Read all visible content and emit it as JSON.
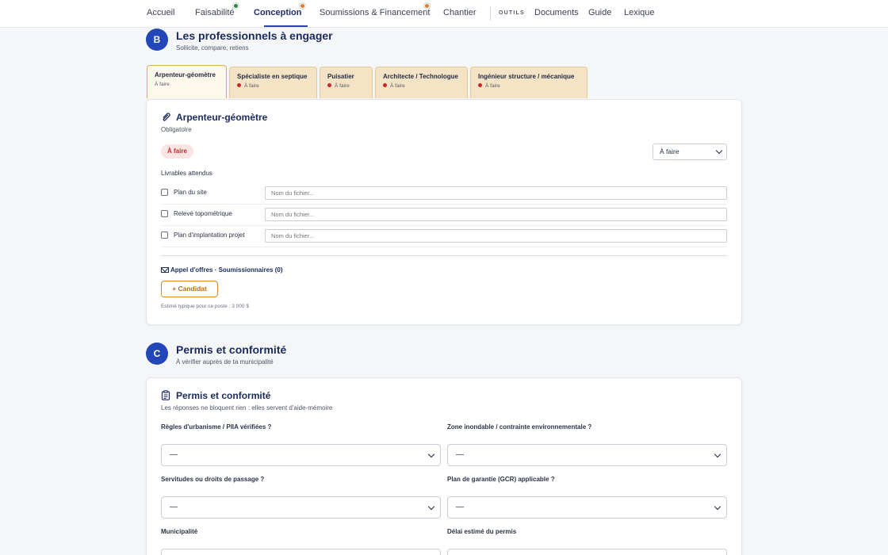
{
  "nav": {
    "items": [
      {
        "label": "Accueil"
      },
      {
        "label": "Faisabilité",
        "dot": "green"
      },
      {
        "label": "Conception",
        "dot": "orange",
        "active": true
      },
      {
        "label": "Soumissions & Financement",
        "dot": "orange"
      },
      {
        "label": "Chantier"
      }
    ],
    "tools_heading": "OUTILS",
    "tools": [
      {
        "label": "Documents"
      },
      {
        "label": "Guide"
      },
      {
        "label": "Lexique"
      }
    ]
  },
  "section_b": {
    "letter": "B",
    "title": "Les professionnels à engager",
    "subtitle": "Sollicite, compare, retiens",
    "tabs": [
      {
        "label": "Arpenteur-géomètre",
        "status": "À faire",
        "active": true
      },
      {
        "label": "Spécialiste en septique",
        "status": "À faire"
      },
      {
        "label": "Puisatier",
        "status": "À faire"
      },
      {
        "label": "Architecte / Technologue",
        "status": "À faire"
      },
      {
        "label": "Ingénieur structure / mécanique",
        "status": "À faire"
      }
    ],
    "card": {
      "icon": "paperclip-icon",
      "title": "Arpenteur-géomètre",
      "subtitle": "Obligatoire",
      "badge": "À faire",
      "status_select": "À faire",
      "deliverables_heading": "Livrables attendus",
      "deliverables": [
        {
          "label": "Plan du site",
          "placeholder": "Nom du fichier..."
        },
        {
          "label": "Relevé topométrique",
          "placeholder": "Nom du fichier..."
        },
        {
          "label": "Plan d'implantation projet",
          "placeholder": "Nom du fichier..."
        }
      ],
      "tender_label": "Appel d'offres · Soumissionnaires (0)",
      "candidate_button": "+ Candidat",
      "estimate": "Estimé typique pour ce poste : 3 000 $"
    }
  },
  "section_c": {
    "letter": "C",
    "title": "Permis et conformité",
    "subtitle": "À vérifier auprès de ta municipalité",
    "card": {
      "icon": "clipboard-icon",
      "title": "Permis et conformité",
      "subtitle": "Les réponses ne bloquent rien : elles servent d'aide-mémoire",
      "fields": [
        {
          "label": "Règles d'urbanisme / PIIA vérifiées ?",
          "value": "—"
        },
        {
          "label": "Zone inondable / contrainte environnementale ?",
          "value": "—"
        },
        {
          "label": "Servitudes ou droits de passage ?",
          "value": "—"
        },
        {
          "label": "Plan de garantie (GCR) applicable ?",
          "value": "—"
        },
        {
          "label": "Municipalité",
          "value": ""
        },
        {
          "label": "Délai estimé du permis",
          "value": ""
        }
      ]
    }
  },
  "colors": {
    "accent": "#2346b8",
    "title": "#1a2a5e",
    "tab_bg": "#f4e3c4",
    "status_red": "#c62828",
    "candidate_orange": "#d08a2a"
  }
}
